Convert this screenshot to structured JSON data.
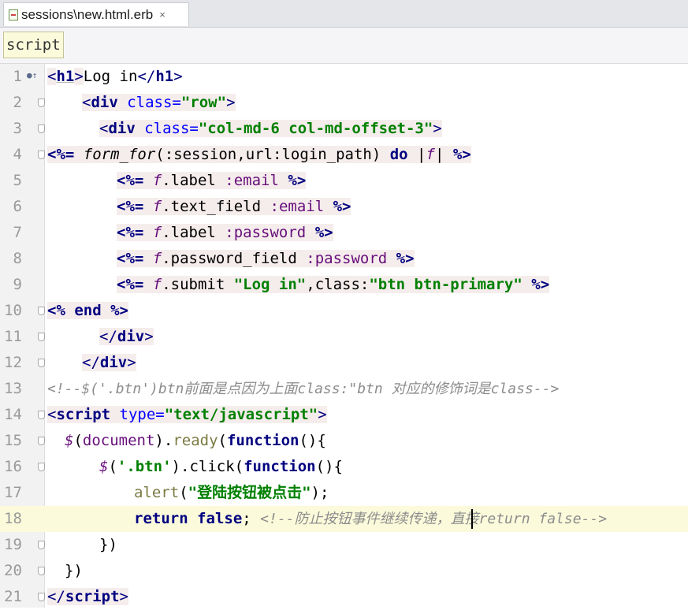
{
  "tab": {
    "title": "sessions\\new.html.erb",
    "close": "×"
  },
  "breadcrumb": {
    "label": "script"
  },
  "line_numbers": [
    "1",
    "2",
    "3",
    "4",
    "5",
    "6",
    "7",
    "8",
    "9",
    "10",
    "11",
    "12",
    "13",
    "14",
    "15",
    "16",
    "17",
    "18",
    "19",
    "20",
    "21"
  ],
  "code": {
    "l1": {
      "open": "<",
      "tag": "h1",
      "close": ">",
      "text": "Log in",
      "end_open": "</",
      "end_tag": "h1",
      "end_close": ">"
    },
    "l2": {
      "open": "<",
      "tag": "div",
      "attr": " class=",
      "value": "\"row\"",
      "close": ">"
    },
    "l3": {
      "open": "<",
      "tag": "div",
      "attr": " class=",
      "value": "\"col-md-6 col-md-offset-3\"",
      "close": ">"
    },
    "l4": {
      "start": "<%= ",
      "method": "form_for",
      "p1": "(",
      "sym": ":session",
      "p2": ",url:login_path) ",
      "kw": "do",
      "sp": " |",
      "var": "f",
      "p3": "| ",
      "end": "%>"
    },
    "l5": {
      "start": "<%= ",
      "var": "f",
      "body": ".label ",
      "sym": ":email",
      "sp": " ",
      "end": "%>"
    },
    "l6": {
      "start": "<%= ",
      "var": "f",
      "body": ".text_field ",
      "sym": ":email",
      "sp": " ",
      "end": "%>"
    },
    "l7": {
      "start": "<%= ",
      "var": "f",
      "body": ".label ",
      "sym": ":password",
      "sp": " ",
      "end": "%>"
    },
    "l8": {
      "start": "<%= ",
      "var": "f",
      "body": ".password_field ",
      "sym": ":password",
      "sp": " ",
      "end": "%>"
    },
    "l9": {
      "start": "<%= ",
      "var": "f",
      "body": ".submit ",
      "str1": "\"Log in\"",
      "mid": ",class:",
      "str2": "\"btn btn-primary\"",
      "sp": " ",
      "end": "%>"
    },
    "l10": {
      "start": "<%",
      "kw": " end ",
      "end": "%>"
    },
    "l11": {
      "open": "</",
      "tag": "div",
      "close": ">"
    },
    "l12": {
      "open": "</",
      "tag": "div",
      "close": ">"
    },
    "l13": {
      "comment": "<!--$('.btn')btn前面是点因为上面class:\"btn 对应的修饰词是class-->"
    },
    "l14": {
      "open": "<",
      "tag": "script",
      "attr": " type=",
      "value": "\"text/javascript\"",
      "close": ">"
    },
    "l15": {
      "jq": "$",
      "p1": "(",
      "doc": "document",
      "p2": ").",
      "ready": "ready",
      "p3": "(",
      "kw": "function",
      "p4": "(){"
    },
    "l16": {
      "jq": "$",
      "p1": "(",
      "sel": "'.btn'",
      "p2": ").",
      "click": "click",
      "p3": "(",
      "kw": "function",
      "p4": "(){"
    },
    "l17": {
      "alert": "alert",
      "p1": "(",
      "str": "\"登陆按钮被点击\"",
      "p2": ");"
    },
    "l18": {
      "kw": "return false",
      "semi": "; ",
      "comment": "<!--防止按钮事件继续传递，直接return false-->"
    },
    "l19": {
      "text": "})"
    },
    "l20": {
      "text": "})"
    },
    "l21": {
      "open": "</",
      "tag": "script",
      "close": ">"
    }
  }
}
